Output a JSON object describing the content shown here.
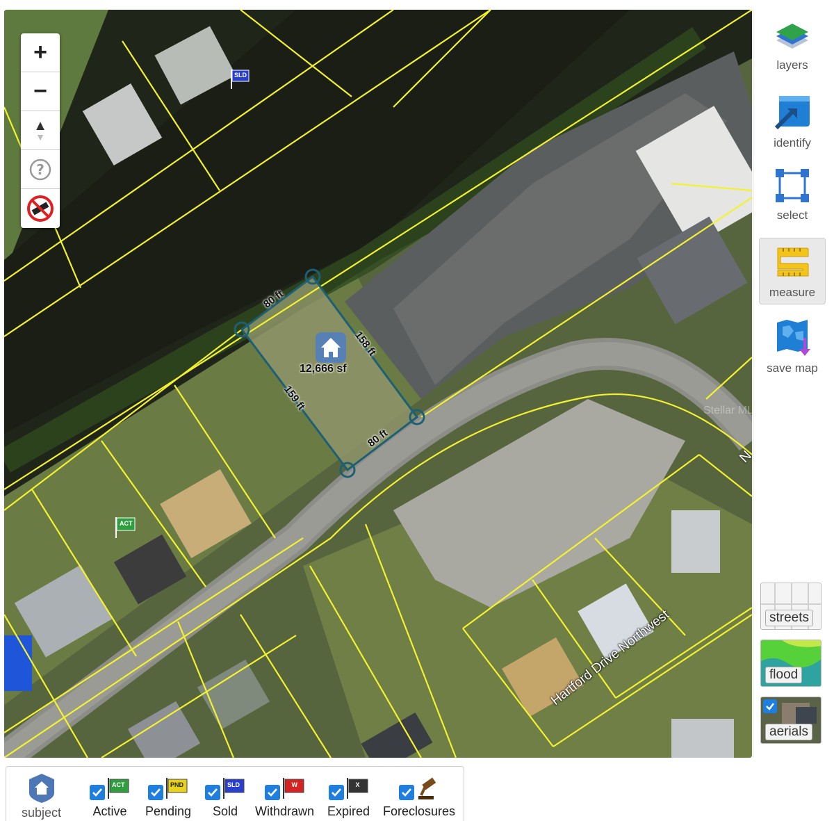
{
  "map": {
    "parcel": {
      "area_label": "12,666 sf",
      "edges": [
        "80 ft",
        "158 ft",
        "159 ft",
        "80 ft"
      ]
    },
    "street_name": "Hartford Drive Northwest",
    "street_fragment": "N",
    "watermark": "Stellar MLS",
    "markers": [
      {
        "label": "SLD"
      },
      {
        "label": "ACT"
      }
    ]
  },
  "zoom_controls": {
    "zoom_in": "+",
    "zoom_out": "−",
    "north": "▲"
  },
  "sidebar": {
    "tools": [
      {
        "id": "layers",
        "label": "layers"
      },
      {
        "id": "identify",
        "label": "identify"
      },
      {
        "id": "select",
        "label": "select"
      },
      {
        "id": "measure",
        "label": "measure",
        "active": true
      },
      {
        "id": "save-map",
        "label": "save map"
      }
    ],
    "basemaps": [
      {
        "id": "streets",
        "label": "streets"
      },
      {
        "id": "flood",
        "label": "flood"
      },
      {
        "id": "aerials",
        "label": "aerials",
        "checked": true
      }
    ]
  },
  "legend": {
    "subject_label": "subject",
    "items": [
      {
        "label": "Active",
        "tag": "ACT",
        "color": "#2f9e3f"
      },
      {
        "label": "Pending",
        "tag": "PND",
        "color": "#e8d21d"
      },
      {
        "label": "Sold",
        "tag": "SLD",
        "color": "#2b3fcf"
      },
      {
        "label": "Withdrawn",
        "tag": "W",
        "color": "#d32323"
      },
      {
        "label": "Expired",
        "tag": "X",
        "color": "#333333"
      },
      {
        "label": "Foreclosures",
        "tag": "",
        "color": "#7a4a1c"
      }
    ]
  },
  "colors": {
    "parcel_line": "#f2f230",
    "measure_line": "#1d5f73",
    "accent": "#1f7fe0"
  }
}
